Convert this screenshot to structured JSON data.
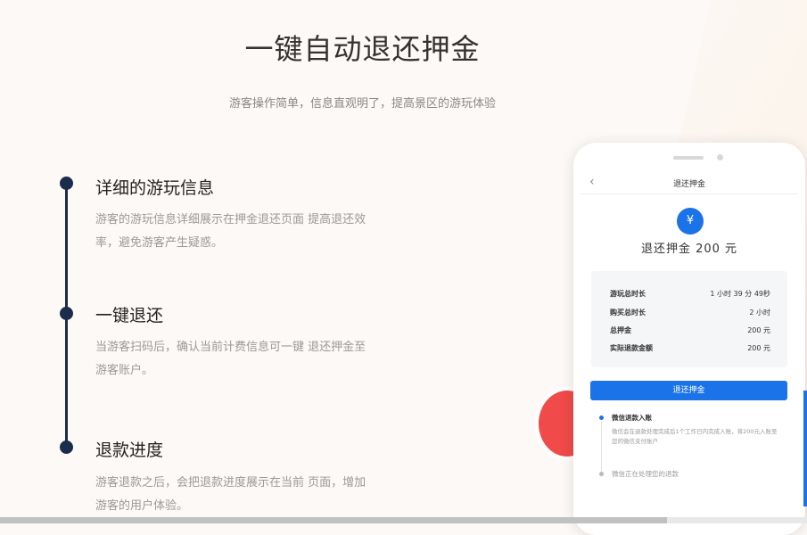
{
  "header": {
    "title": "一键自动退还押金",
    "subtitle": "游客操作简单，信息直观明了，提高景区的游玩体验"
  },
  "features": [
    {
      "title": "详细的游玩信息",
      "desc": "游客的游玩信息详细展示在押金退还页面 提高退还效率，避免游客产生疑惑。"
    },
    {
      "title": "一键退还",
      "desc": "当游客扫码后，确认当前计费信息可一键 退还押金至游客账户。"
    },
    {
      "title": "退款进度",
      "desc": "游客退款之后，会把退款进度展示在当前 页面，增加游客的用户体验。"
    }
  ],
  "phone": {
    "back_icon": "‹",
    "nav_title": "退还押金",
    "yen_symbol": "¥",
    "amount": "退还押金 200 元",
    "rows": [
      {
        "label": "游玩总时长",
        "value": "1 小时 39 分 49秒"
      },
      {
        "label": "购买总时长",
        "value": "2 小时"
      },
      {
        "label": "总押金",
        "value": "200 元"
      },
      {
        "label": "实际退款金额",
        "value": "200 元"
      }
    ],
    "button_label": "退还押金",
    "progress": [
      {
        "title": "微信退款入账",
        "desc": "微信会在退款处理完成后1个工作日内完成入账，将200元入账至您的微信支付账户"
      },
      {
        "title": "微信正在处理您的退款",
        "desc": ""
      }
    ]
  },
  "colors": {
    "accent": "#1a73e8",
    "timeline": "#1b2d4d",
    "blob": "#f04a4a",
    "yellow": "#ffd21f"
  },
  "scrollbar": {
    "position_percent": 83
  }
}
